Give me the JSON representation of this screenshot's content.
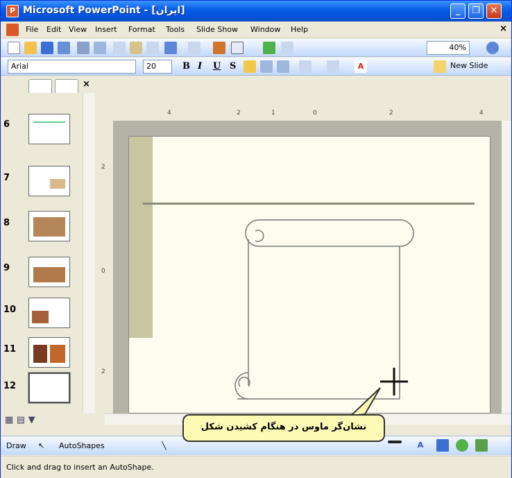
{
  "window": {
    "title": "Microsoft PowerPoint - [ایران]"
  },
  "menu": {
    "items": [
      "File",
      "Edit",
      "View",
      "Insert",
      "Format",
      "Tools",
      "Slide Show",
      "Window",
      "Help"
    ]
  },
  "toolbar": {
    "zoom": "40%",
    "font": "Arial",
    "font_size": "20",
    "bold": "B",
    "italic": "I",
    "underline": "U",
    "shadow": "S",
    "new_slide": "New Slide"
  },
  "thumbnails": {
    "numbers": [
      "6",
      "7",
      "8",
      "9",
      "10",
      "11",
      "12"
    ]
  },
  "ruler": {
    "h_labels": [
      "4",
      "2",
      "0",
      "2",
      "4",
      "1"
    ],
    "v_labels": [
      "2",
      "0",
      "2"
    ]
  },
  "drawbar": {
    "draw": "Draw",
    "autoshapes": "AutoShapes"
  },
  "status": {
    "text": "Click and drag to insert an AutoShape."
  },
  "callout": {
    "text": "نشان‌گر ماوس در هنگام کشیدن شکل"
  },
  "colors": {
    "titlebar": "#0a5fe8",
    "slide_bg": "#fdfcef",
    "callout_bg": "#fdfbb5",
    "stripe": "#c8c6a0"
  }
}
